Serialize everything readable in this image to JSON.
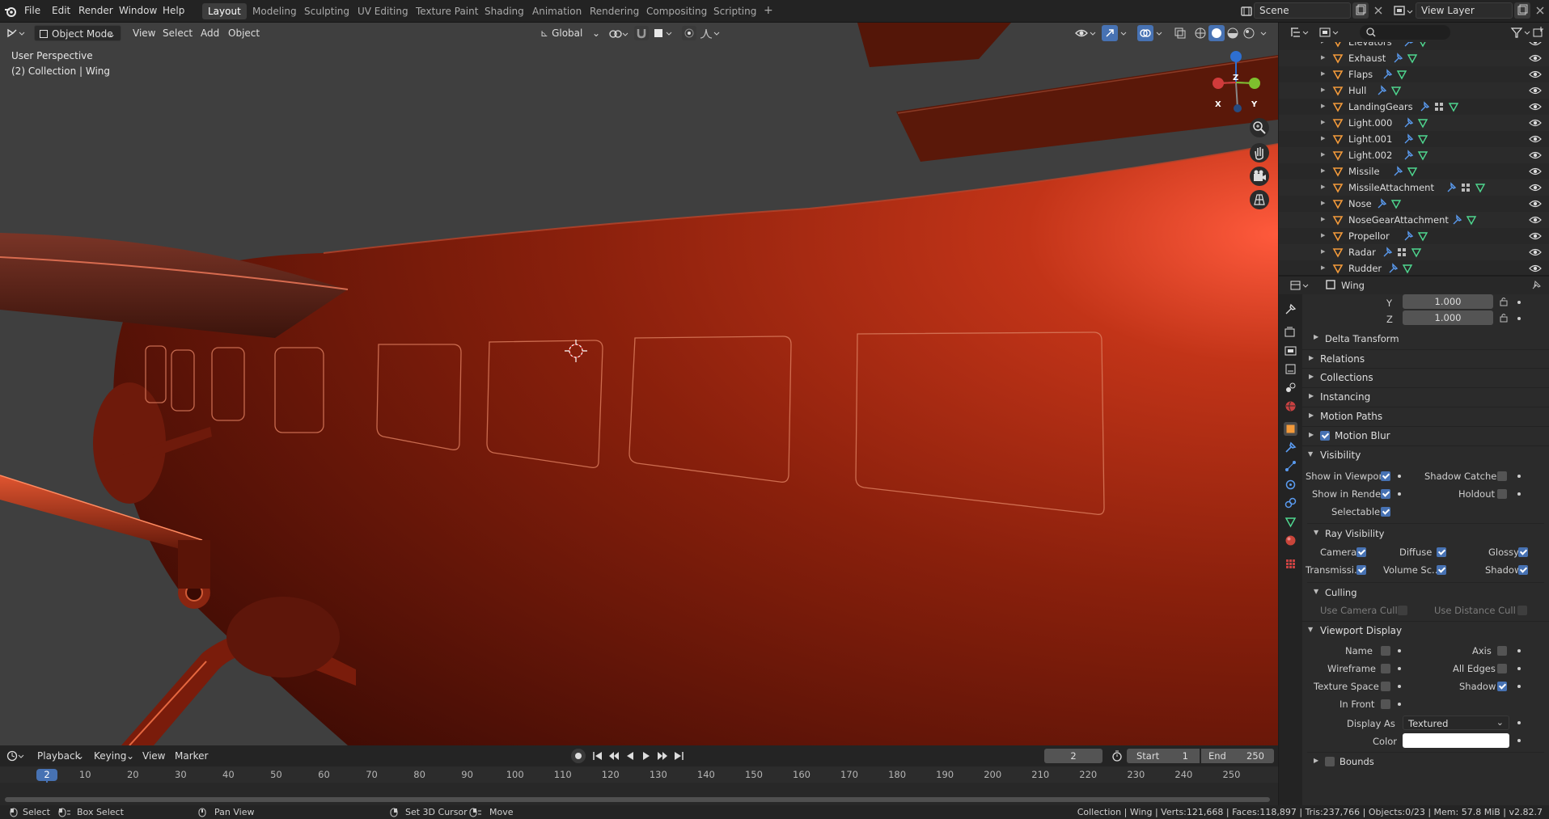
{
  "topbar": {
    "menus": [
      "File",
      "Edit",
      "Render",
      "Window",
      "Help"
    ],
    "workspaces": [
      "Layout",
      "Modeling",
      "Sculpting",
      "UV Editing",
      "Texture Paint",
      "Shading",
      "Animation",
      "Rendering",
      "Compositing",
      "Scripting"
    ],
    "active_workspace": "Layout",
    "add_tab": "+",
    "scene": "Scene",
    "view_layer": "View Layer"
  },
  "viewport": {
    "mode": "Object Mode",
    "menus": [
      "View",
      "Select",
      "Add",
      "Object"
    ],
    "transform_orientation": "Global",
    "perspective_label": "User Perspective",
    "collection_label": "(2) Collection | Wing",
    "gizmo": {
      "x": "X",
      "y": "Y",
      "z": "Z"
    },
    "model_color": "#8c1f0a"
  },
  "outliner": {
    "items": [
      {
        "name": "Elevators"
      },
      {
        "name": "Exhaust"
      },
      {
        "name": "Flaps"
      },
      {
        "name": "Hull"
      },
      {
        "name": "LandingGears"
      },
      {
        "name": "Light.000"
      },
      {
        "name": "Light.001"
      },
      {
        "name": "Light.002"
      },
      {
        "name": "Missile"
      },
      {
        "name": "MissileAttachment"
      },
      {
        "name": "Nose"
      },
      {
        "name": "NoseGearAttachment"
      },
      {
        "name": "Propellor"
      },
      {
        "name": "Radar"
      },
      {
        "name": "Rudder"
      }
    ]
  },
  "properties": {
    "object_name": "Wing",
    "scale": {
      "y_label": "Y",
      "y": "1.000",
      "z_label": "Z",
      "z": "1.000"
    },
    "collapsed_panels": [
      "Delta Transform",
      "Relations",
      "Collections",
      "Instancing",
      "Motion Paths",
      "Motion Blur"
    ],
    "visibility": {
      "title": "Visibility",
      "show_in_viewport": "Show in Viewpor...",
      "shadow_catcher": "Shadow Catcher",
      "show_in_renders": "Show in Renders",
      "holdout": "Holdout",
      "selectable": "Selectable",
      "ray_visibility": "Ray Visibility",
      "camera": "Camera",
      "diffuse": "Diffuse",
      "glossy": "Glossy",
      "transmission": "Transmissi...",
      "volume_scatter": "Volume Sc...",
      "shadow": "Shadow",
      "culling": "Culling",
      "use_camera_cull": "Use Camera Cull",
      "use_distance_cull": "Use Distance Cull"
    },
    "viewport_display": {
      "title": "Viewport Display",
      "name": "Name",
      "axis": "Axis",
      "wireframe": "Wireframe",
      "all_edges": "All Edges",
      "texture_space": "Texture Space",
      "shadow": "Shadow",
      "in_front": "In Front",
      "display_as_label": "Display As",
      "display_as": "Textured",
      "color_label": "Color",
      "bounds": "Bounds"
    }
  },
  "timeline": {
    "menus": [
      "Playback",
      "Keying",
      "View",
      "Marker"
    ],
    "current_frame": "2",
    "start_label": "Start",
    "start": "1",
    "end_label": "End",
    "end": "250",
    "ticks": [
      "2",
      "10",
      "20",
      "30",
      "40",
      "50",
      "60",
      "70",
      "80",
      "90",
      "100",
      "110",
      "120",
      "130",
      "140",
      "150",
      "160",
      "170",
      "180",
      "190",
      "200",
      "210",
      "220",
      "230",
      "240",
      "250"
    ]
  },
  "statusbar": {
    "select": "Select",
    "box_select": "Box Select",
    "pan_view": "Pan View",
    "set_cursor": "Set 3D Cursor",
    "move": "Move",
    "stats": "Collection | Wing | Verts:121,668 | Faces:118,897 | Tris:237,766 | Objects:0/23 | Mem: 57.8 MiB | v2.82.7"
  }
}
